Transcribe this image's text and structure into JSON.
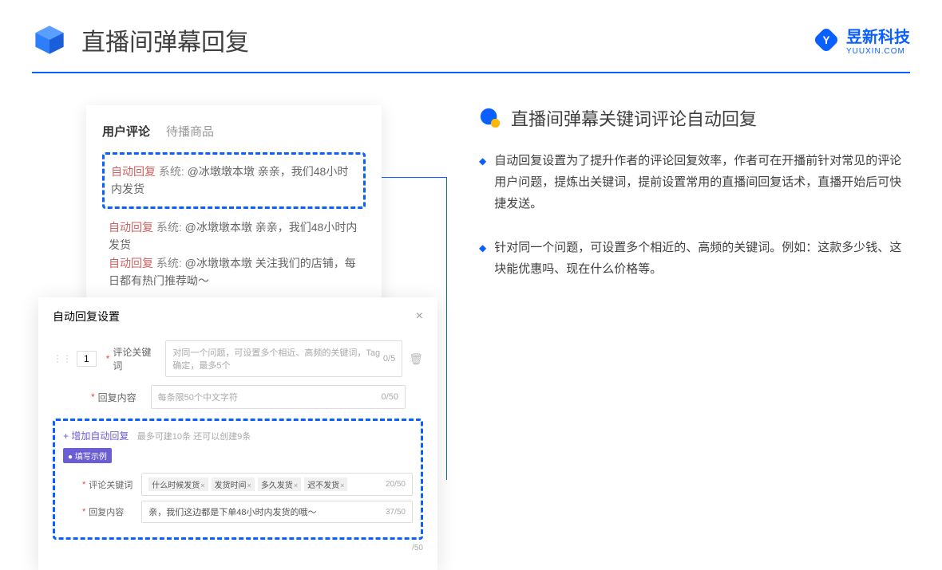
{
  "header": {
    "title": "直播间弹幕回复"
  },
  "brand": {
    "name": "昱新科技",
    "sub": "YUUXIN.COM"
  },
  "card1": {
    "tab1": "用户评论",
    "tab2": "待播商品",
    "highlight": {
      "tag": "自动回复",
      "sys": " 系统: ",
      "text": "@冰墩墩本墩 亲亲，我们48小时内发货"
    },
    "r2": {
      "tag": "自动回复",
      "sys": " 系统: ",
      "text": "@冰墩墩本墩 亲亲，我们48小时内发货"
    },
    "r3": {
      "tag": "自动回复",
      "sys": " 系统: ",
      "text": "@冰墩墩本墩 关注我们的店铺，每日都有热门推荐呦～"
    }
  },
  "card2": {
    "title": "自动回复设置",
    "num": "1",
    "label1": "评论关键词",
    "ph1": "对同一个问题，可设置多个相近、高频的关键词，Tag确定，最多5个",
    "count1": "0/5",
    "label2": "回复内容",
    "ph2": "每条限50个中文字符",
    "count2": "0/50",
    "addLink": "+ 增加自动回复",
    "hint": "最多可建10条 还可以创建9条",
    "badge": "● 填写示例",
    "exLabel1": "评论关键词",
    "tags": [
      "什么时候发货",
      "发货时间",
      "多久发货",
      "迟不发货"
    ],
    "exCount1": "20/50",
    "exLabel2": "回复内容",
    "exText": "亲，我们这边都是下单48小时内发货的哦～",
    "exCount2": "37/50",
    "outCount": "/50"
  },
  "section": {
    "title": "直播间弹幕关键词评论自动回复",
    "b1": "自动回复设置为了提升作者的评论回复效率，作者可在开播前针对常见的评论用户问题，提炼出关键词，提前设置常用的直播间回复话术，直播开始后可快捷发送。",
    "b2": "针对同一个问题，可设置多个相近的、高频的关键词。例如：这款多少钱、这块能优惠吗、现在什么价格等。"
  }
}
